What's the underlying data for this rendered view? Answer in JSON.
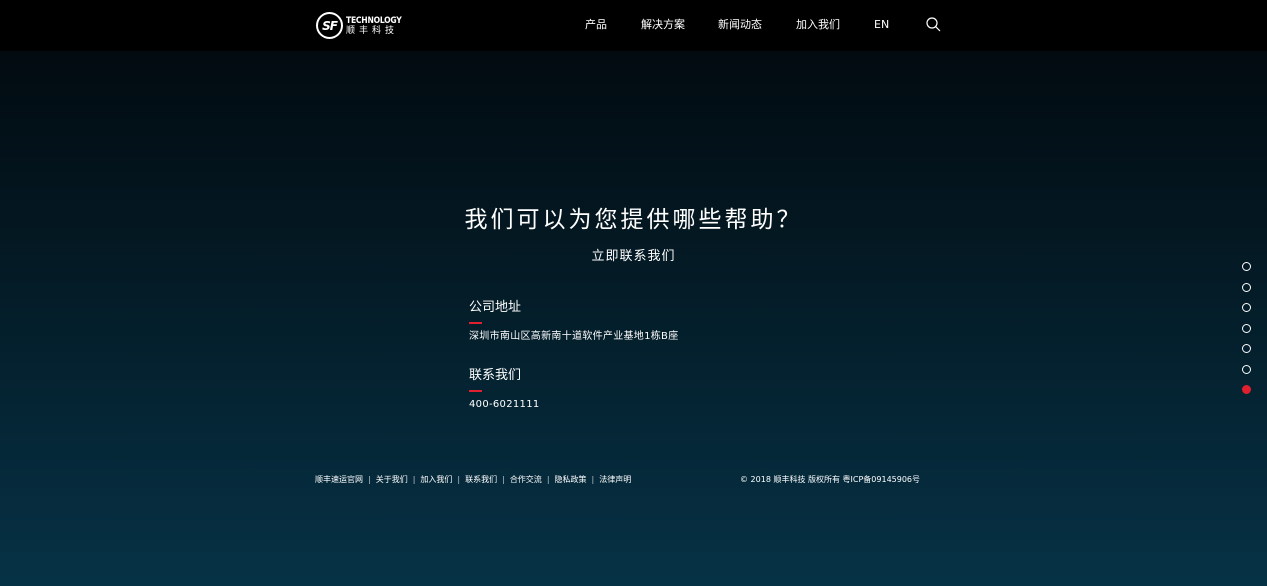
{
  "header": {
    "logo": {
      "mark": "SF",
      "text_en": "TECHNOLOGY",
      "text_cn": "顺丰科技"
    },
    "nav": [
      {
        "label": "产品"
      },
      {
        "label": "解决方案"
      },
      {
        "label": "新闻动态"
      },
      {
        "label": "加入我们"
      },
      {
        "label": "EN"
      }
    ],
    "search_icon": "search-icon"
  },
  "main": {
    "headline": "我们可以为您提供哪些帮助？",
    "subhead": "立即联系我们",
    "address": {
      "title": "公司地址",
      "value": "深圳市南山区高新南十道软件产业基地1栋B座"
    },
    "contact": {
      "title": "联系我们",
      "value": "400-6021111"
    }
  },
  "footer": {
    "links": [
      {
        "label": "顺丰速运官网"
      },
      {
        "label": "关于我们"
      },
      {
        "label": "加入我们"
      },
      {
        "label": "联系我们"
      },
      {
        "label": "合作交流"
      },
      {
        "label": "隐私政策"
      },
      {
        "label": "法律声明"
      }
    ],
    "separator": "|",
    "copyright": "© 2018 顺丰科技 版权所有 粤ICP备09145906号"
  },
  "page_dots": {
    "count": 7,
    "active_index": 6
  },
  "colors": {
    "accent": "#e0202f",
    "header_bg": "#000000",
    "bg_top": "#01070b",
    "bg_bottom": "#063246"
  }
}
